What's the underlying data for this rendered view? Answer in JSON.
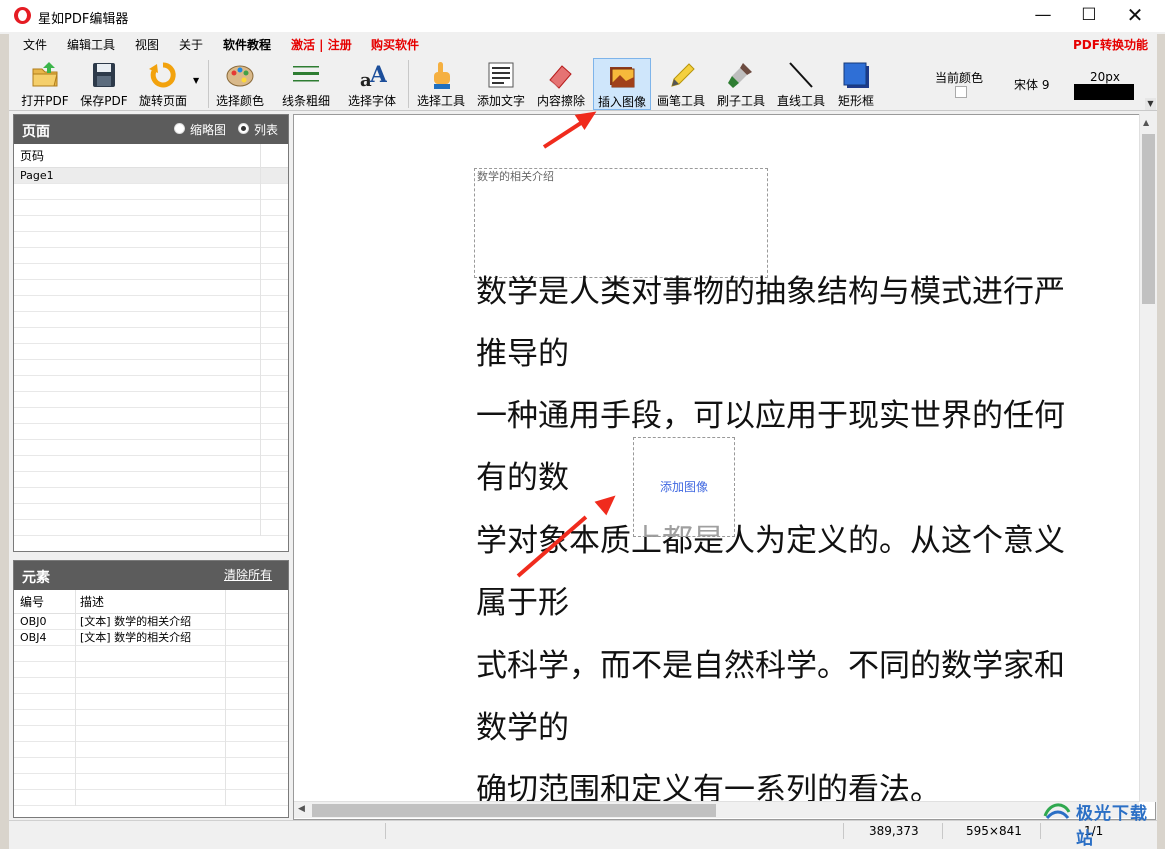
{
  "window": {
    "title": "星如PDF编辑器",
    "minimize": "—",
    "maximize": "☐",
    "close": "✕"
  },
  "menu": {
    "items": [
      "文件",
      "编辑工具",
      "视图",
      "关于",
      "软件教程",
      "激活 | 注册",
      "购买软件"
    ],
    "pdf_convert": "PDF转换功能"
  },
  "toolbar": {
    "tools": [
      {
        "label": "打开PDF",
        "icon": "open-folder-icon"
      },
      {
        "label": "保存PDF",
        "icon": "save-disk-icon"
      },
      {
        "label": "旋转页面",
        "icon": "rotate-icon"
      },
      {
        "label": "选择颜色",
        "icon": "palette-icon"
      },
      {
        "label": "线条粗细",
        "icon": "line-width-icon"
      },
      {
        "label": "选择字体",
        "icon": "font-icon"
      },
      {
        "label": "选择工具",
        "icon": "pointer-hand-icon"
      },
      {
        "label": "添加文字",
        "icon": "add-text-icon"
      },
      {
        "label": "内容擦除",
        "icon": "eraser-icon"
      },
      {
        "label": "插入图像",
        "icon": "insert-image-icon"
      },
      {
        "label": "画笔工具",
        "icon": "pencil-icon"
      },
      {
        "label": "刷子工具",
        "icon": "brush-icon"
      },
      {
        "label": "直线工具",
        "icon": "line-tool-icon"
      },
      {
        "label": "矩形框",
        "icon": "rectangle-icon"
      }
    ],
    "active_tool": "插入图像",
    "current_color_label": "当前颜色",
    "current_color": "#ffffff",
    "font_label": "宋体 9",
    "size_label": "20px"
  },
  "pages_panel": {
    "title": "页面",
    "view_thumbnail": "缩略图",
    "view_list": "列表",
    "selected_view": "列表",
    "column_header": "页码",
    "rows": [
      "Page1"
    ]
  },
  "elements_panel": {
    "title": "元素",
    "clear_all": "清除所有",
    "columns": [
      "编号",
      "描述"
    ],
    "rows": [
      {
        "id": "OBJ0",
        "desc": "[文本] 数学的相关介绍"
      },
      {
        "id": "OBJ4",
        "desc": "[文本] 数学的相关介绍"
      }
    ]
  },
  "document": {
    "text_box_label": "数学的相关介绍",
    "lines": [
      "数学是人类对事物的抽象结构与模式进行严",
      "推导的",
      "一种通用手段，可以应用于现实世界的任何",
      "有的数",
      "学对象本质上都是人为定义的。从这个意义",
      "属于形",
      "式科学，而不是自然科学。不同的数学家和",
      "数学的",
      "确切范围和定义有一系列的看法。"
    ],
    "image_placeholder_label": "添加图像"
  },
  "status": {
    "coords": "389,373",
    "page_size": "595×841",
    "page_index": "1/1"
  },
  "watermark": {
    "text": "极光下载站"
  },
  "colors": {
    "accent_red": "#e60000",
    "annotation_arrow": "#f02b1d",
    "panel_header": "#5c5c5c",
    "placeholder_text": "#4169e1"
  }
}
